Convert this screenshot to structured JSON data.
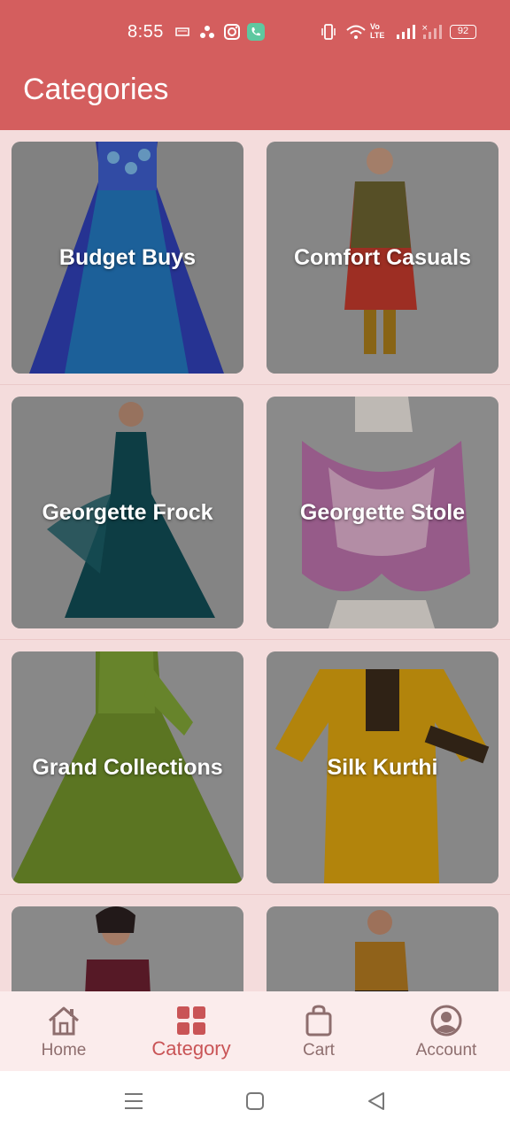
{
  "status": {
    "time": "8:55",
    "battery": "92",
    "net_label": "Vo LTE"
  },
  "header": {
    "title": "Categories"
  },
  "categories": [
    {
      "label": "Budget Buys"
    },
    {
      "label": "Comfort Casuals"
    },
    {
      "label": "Georgette Frock"
    },
    {
      "label": "Georgette Stole"
    },
    {
      "label": "Grand Collections"
    },
    {
      "label": "Silk Kurthi"
    }
  ],
  "nav": {
    "home": "Home",
    "category": "Category",
    "cart": "Cart",
    "account": "Account"
  },
  "colors": {
    "brand": "#d45e5e",
    "background": "#f4dcdc",
    "nav_active": "#c95456",
    "nav_inactive": "#8e6e6e"
  }
}
